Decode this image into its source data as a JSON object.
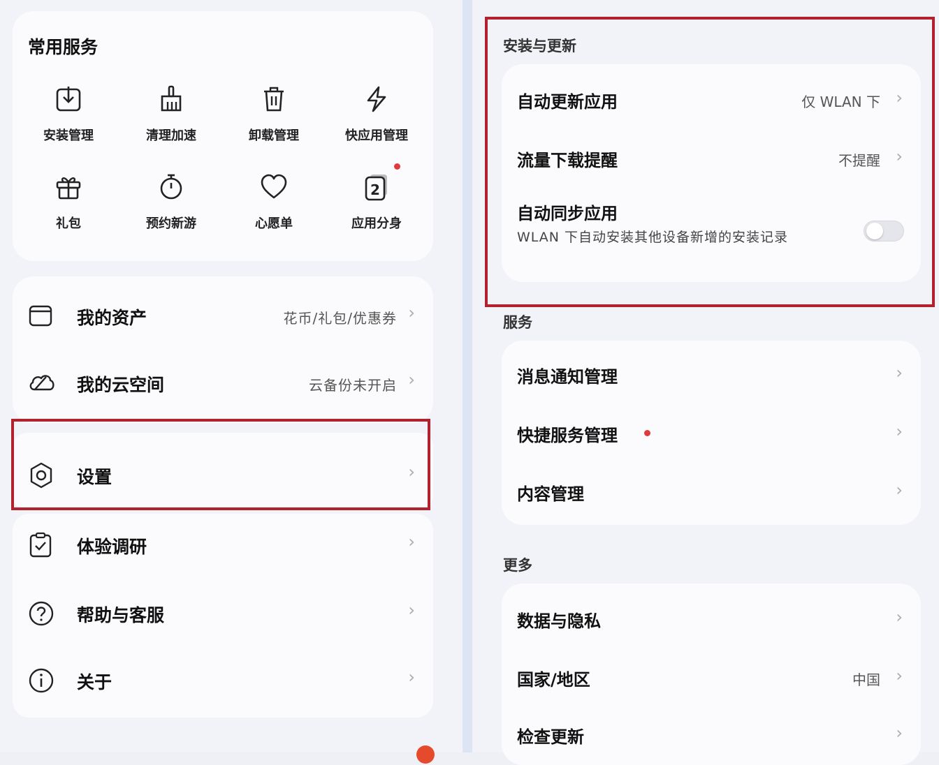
{
  "common_services": {
    "title": "常用服务",
    "items": [
      {
        "label": "安装管理",
        "icon": "download-box-icon"
      },
      {
        "label": "清理加速",
        "icon": "broom-icon"
      },
      {
        "label": "卸载管理",
        "icon": "trash-icon"
      },
      {
        "label": "快应用管理",
        "icon": "lightning-icon"
      },
      {
        "label": "礼包",
        "icon": "gift-icon"
      },
      {
        "label": "预约新游",
        "icon": "stopwatch-icon"
      },
      {
        "label": "心愿单",
        "icon": "heart-icon"
      },
      {
        "label": "应用分身",
        "icon": "app-clone-icon",
        "badge_text": "2"
      }
    ]
  },
  "my_items": [
    {
      "label": "我的资产",
      "value": "花币/礼包/优惠券",
      "icon": "wallet-icon"
    },
    {
      "label": "我的云空间",
      "value": "云备份未开启",
      "icon": "cloud-icon"
    }
  ],
  "settings": {
    "label": "设置",
    "icon": "gear-icon"
  },
  "other_items": [
    {
      "label": "体验调研",
      "icon": "clipboard-check-icon"
    },
    {
      "label": "帮助与客服",
      "icon": "question-circle-icon"
    },
    {
      "label": "关于",
      "icon": "info-circle-icon"
    }
  ],
  "install_update": {
    "title": "安装与更新",
    "auto_update": {
      "label": "自动更新应用",
      "value": "仅 WLAN 下"
    },
    "data_download": {
      "label": "流量下载提醒",
      "value": "不提醒"
    },
    "auto_sync": {
      "label": "自动同步应用",
      "description": "WLAN 下自动安装其他设备新增的安装记录",
      "enabled": false
    }
  },
  "services": {
    "title": "服务",
    "items": [
      {
        "label": "消息通知管理"
      },
      {
        "label": "快捷服务管理",
        "has_red_dot": true
      },
      {
        "label": "内容管理"
      }
    ]
  },
  "more": {
    "title": "更多",
    "items": [
      {
        "label": "数据与隐私",
        "value": ""
      },
      {
        "label": "国家/地区",
        "value": "中国"
      },
      {
        "label": "检查更新",
        "value": ""
      }
    ]
  },
  "colors": {
    "highlight": "#b3202e",
    "red_dot": "#e03a3e",
    "page_bg": "#f2f3f8",
    "card_bg": "#fbfbfd"
  }
}
